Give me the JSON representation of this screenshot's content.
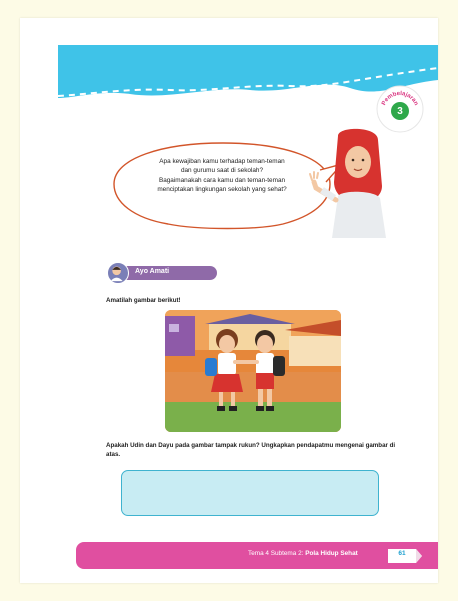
{
  "badge": {
    "label": "Pembelajaran",
    "number": "3"
  },
  "speech_bubble": {
    "lines": [
      "Apa kewajiban kamu terhadap teman-teman",
      "dan gurumu saat di sekolah?",
      "Bagaimanakah cara kamu dan teman-teman",
      "menciptakan lingkungan sekolah yang sehat?"
    ]
  },
  "ayo_amati": {
    "label": "Ayo Amati"
  },
  "instruction": "Amatilah gambar berikut!",
  "question": "Apakah Udin dan Dayu pada gambar tampak rukun? Ungkapkan pendapatmu mengenai gambar di atas.",
  "footer": {
    "theme_text": "Tema 4 Subtema 2: ",
    "theme_bold": "Pola Hidup Sehat",
    "page_number": "61"
  },
  "colors": {
    "banner": "#3fc3e8",
    "footer": "#e04fa0",
    "answer_box": "#c8ecf3",
    "ayo_pill": "#8f6aa8",
    "badge_number": "#2ea84a"
  }
}
